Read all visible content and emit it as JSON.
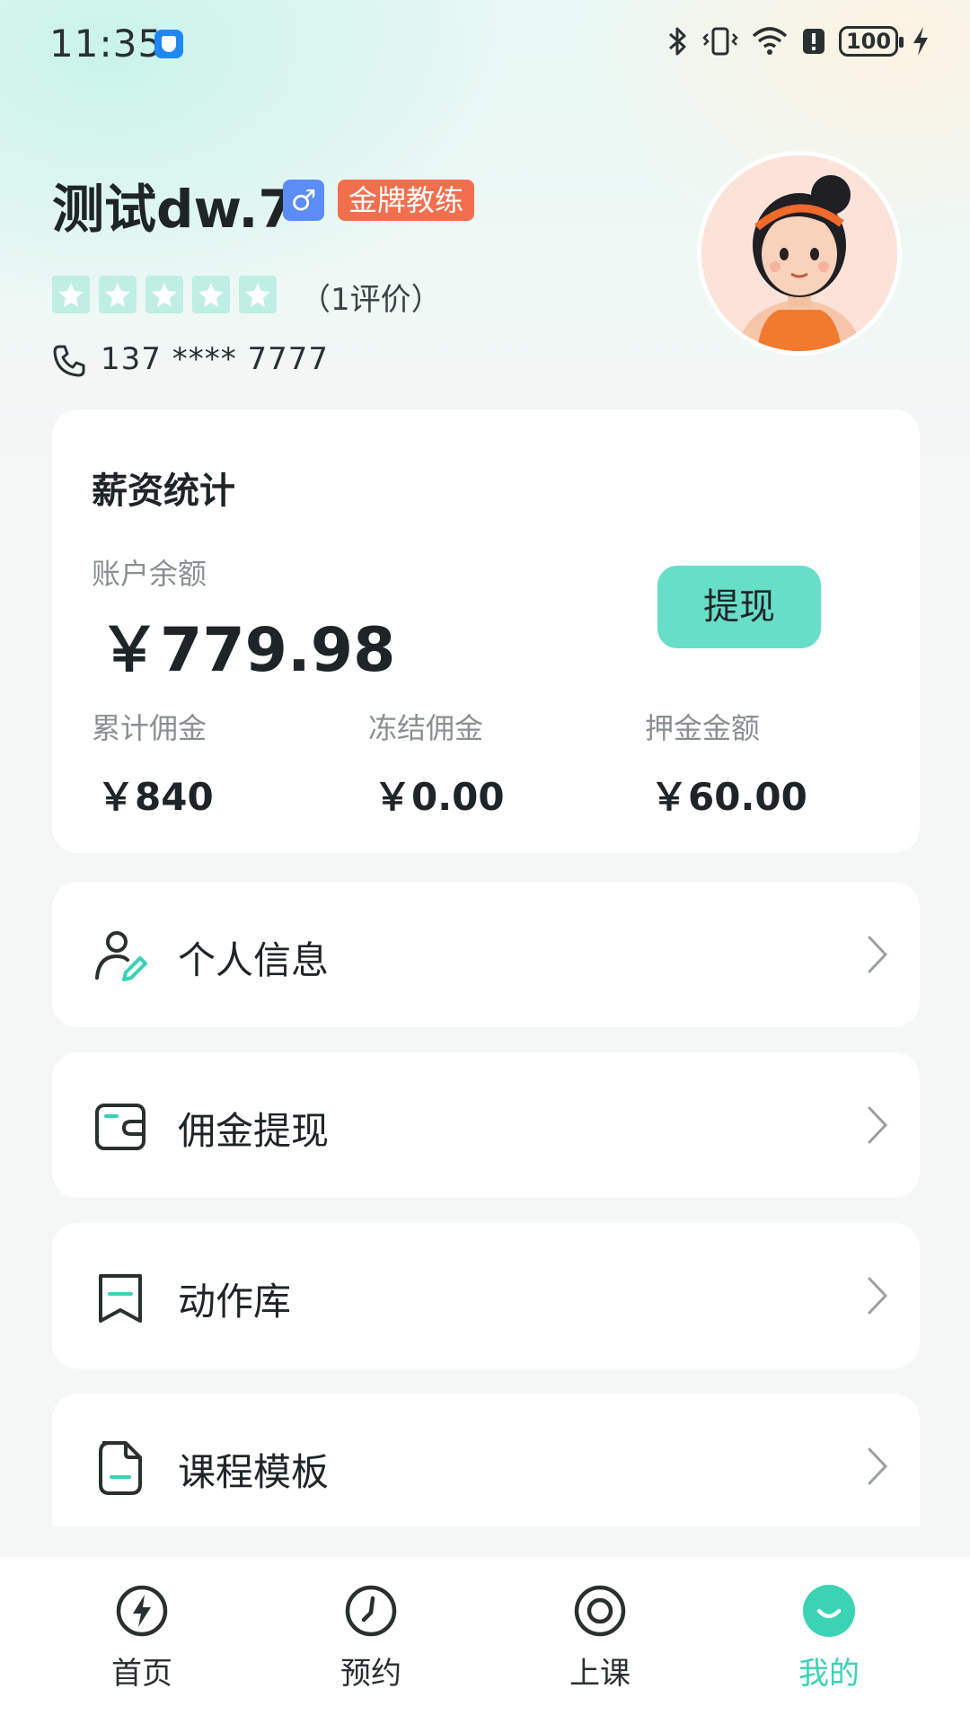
{
  "status_bar": {
    "time": "11:35",
    "battery": "100",
    "icons": [
      "shield-icon",
      "bluetooth-icon",
      "vibrate-icon",
      "wifi-icon",
      "alert-icon",
      "battery-icon",
      "charging-icon"
    ]
  },
  "profile": {
    "name": "测试dw.7",
    "gender_symbol": "♂",
    "badge": "金牌教练",
    "rating_stars": 5,
    "rating_count": "（1评价）",
    "phone": "137 **** 7777"
  },
  "salary": {
    "title": "薪资统计",
    "balance_label": "账户余额",
    "balance_value": "￥779.98",
    "withdraw_label": "提现",
    "stats": [
      {
        "label": "累计佣金",
        "value": "￥840"
      },
      {
        "label": "冻结佣金",
        "value": "￥0.00"
      },
      {
        "label": "押金金额",
        "value": "￥60.00"
      }
    ]
  },
  "menu": [
    {
      "label": "个人信息",
      "icon": "person-edit-icon"
    },
    {
      "label": "佣金提现",
      "icon": "wallet-icon"
    },
    {
      "label": "动作库",
      "icon": "bookmark-icon"
    },
    {
      "label": "课程模板",
      "icon": "document-icon"
    }
  ],
  "tabs": [
    {
      "label": "首页",
      "icon": "lightning-icon",
      "active": false
    },
    {
      "label": "预约",
      "icon": "clock-icon",
      "active": false
    },
    {
      "label": "上课",
      "icon": "target-icon",
      "active": false
    },
    {
      "label": "我的",
      "icon": "smile-icon",
      "active": true
    }
  ],
  "colors": {
    "accent": "#3ad3b4",
    "withdraw_button": "#66dec8",
    "badge": "#f26f4e",
    "gender": "#5b8df5"
  }
}
